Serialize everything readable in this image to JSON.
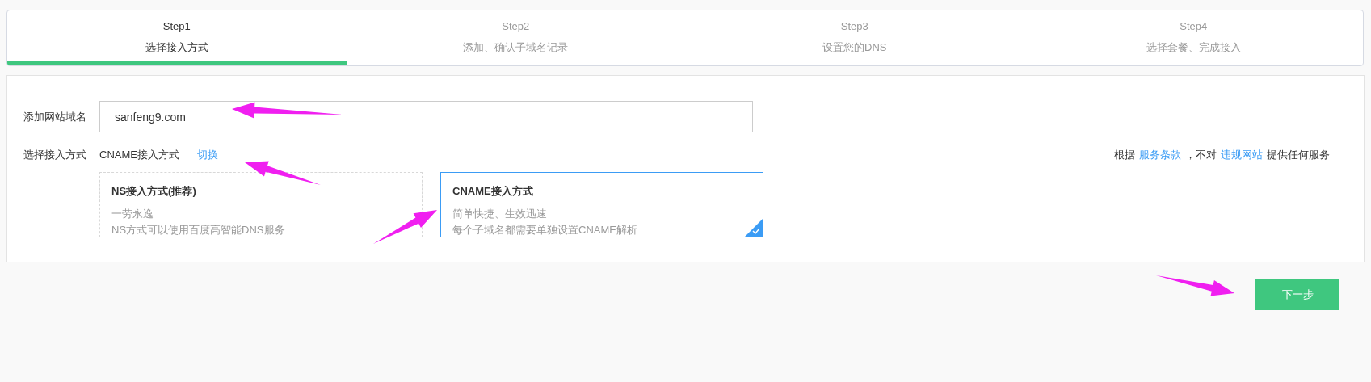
{
  "steps": [
    {
      "title": "Step1",
      "label": "选择接入方式",
      "selected": true
    },
    {
      "title": "Step2",
      "label": "添加、确认子域名记录",
      "selected": false
    },
    {
      "title": "Step3",
      "label": "设置您的DNS",
      "selected": false
    },
    {
      "title": "Step4",
      "label": "选择套餐、完成接入",
      "selected": false
    }
  ],
  "form": {
    "domain_label": "添加网站域名",
    "domain_value": "sanfeng9.com",
    "method_label": "选择接入方式",
    "method_value": "CNAME接入方式",
    "switch_link": "切换",
    "notice": [
      {
        "kind": "text",
        "text": "根据"
      },
      {
        "kind": "link",
        "text": "服务条款"
      },
      {
        "kind": "text",
        "text": "，不对"
      },
      {
        "kind": "link",
        "text": "违规网站"
      },
      {
        "kind": "text",
        "text": "提供任何服务"
      }
    ]
  },
  "options": [
    {
      "title": "NS接入方式(推荐)",
      "lines": [
        "一劳永逸",
        "NS方式可以使用百度高智能DNS服务"
      ],
      "selected": false
    },
    {
      "title": "CNAME接入方式",
      "lines": [
        "简单快捷、生效迅速",
        "每个子域名都需要单独设置CNAME解析"
      ],
      "selected": true
    }
  ],
  "next_button": "下一步"
}
